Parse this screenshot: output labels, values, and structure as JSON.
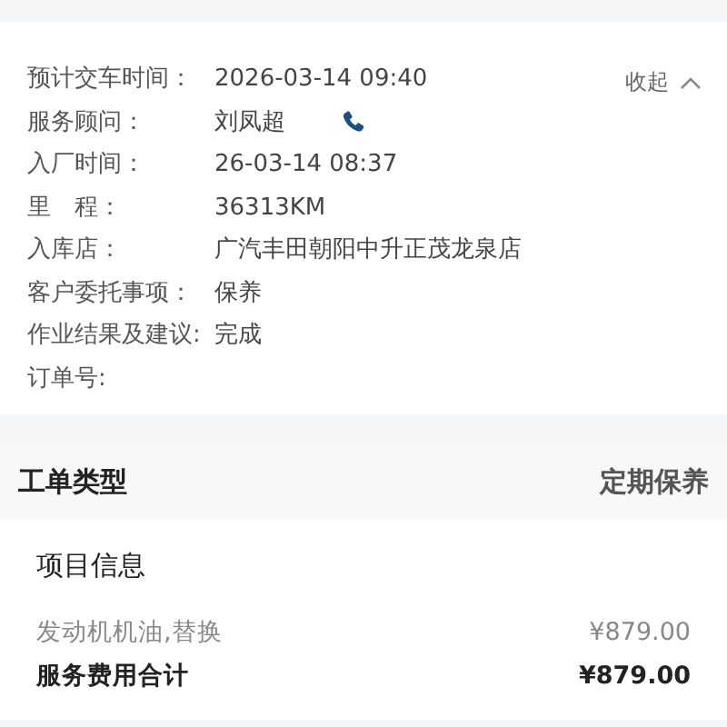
{
  "details": {
    "collapse_label": "收起",
    "rows": [
      {
        "label": "预计交车时间：",
        "value": "2026-03-14 09:40",
        "phone": false
      },
      {
        "label": "服务顾问：",
        "value": "刘凤超",
        "phone": true
      },
      {
        "label": "入厂时间：",
        "value": "26-03-14 08:37",
        "phone": false
      },
      {
        "label": "里　程：",
        "value": "36313KM",
        "phone": false
      },
      {
        "label": "入库店：",
        "value": "广汽丰田朝阳中升正茂龙泉店",
        "phone": false
      },
      {
        "label": "客户委托事项：",
        "value": "保养",
        "phone": false
      },
      {
        "label": "作业结果及建议:",
        "value": "完成",
        "phone": false
      },
      {
        "label": "订单号:",
        "phone": false
      }
    ]
  },
  "order_type": {
    "label": "工单类型",
    "value": "定期保养"
  },
  "project": {
    "title": "项目信息",
    "items": [
      {
        "name": "发动机机油,替换",
        "price": "¥879.00"
      }
    ],
    "total": {
      "label": "服务费用合计",
      "value": "¥879.00"
    }
  }
}
